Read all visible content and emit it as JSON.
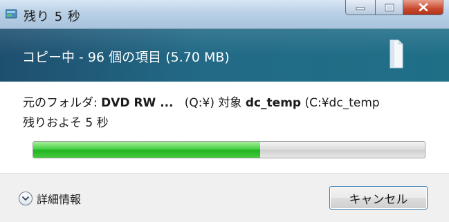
{
  "window": {
    "title": "残り 5 秒"
  },
  "header": {
    "status": "コピー中 - 96 個の項目 (5.70 MB)"
  },
  "details": {
    "source_prefix": "元のフォルダ: ",
    "source_name": "DVD RW ...",
    "source_drive": "(Q:¥)",
    "target_prefix": "対象",
    "target_name": "dc_temp",
    "target_path": "(C:¥dc_temp",
    "time_remaining": "残りおよそ 5 秒"
  },
  "progress": {
    "fraction": 0.58
  },
  "footer": {
    "more_info_label": "詳細情報",
    "cancel_label": "キャンセル"
  },
  "icons": {
    "app": "copy-dialog-icon",
    "header": "file-copy-animation-icon",
    "toggle": "chevron-down-icon"
  }
}
